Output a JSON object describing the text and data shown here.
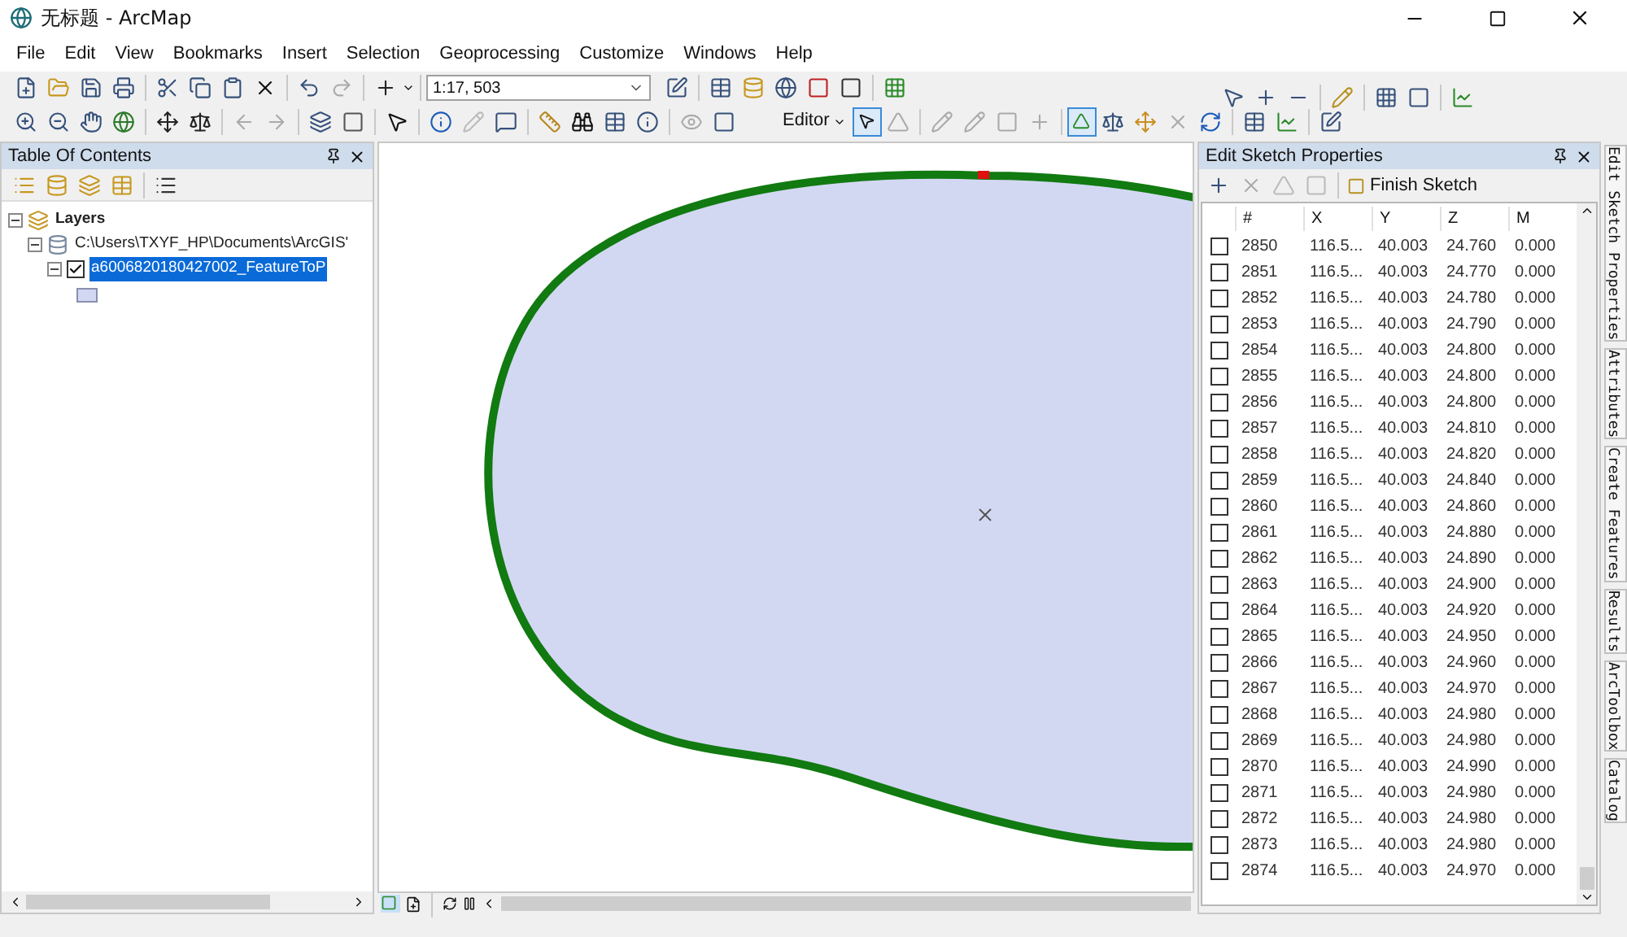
{
  "window": {
    "title": "无标题 - ArcMap"
  },
  "menu": [
    "File",
    "Edit",
    "View",
    "Bookmarks",
    "Insert",
    "Selection",
    "Geoprocessing",
    "Customize",
    "Windows",
    "Help"
  ],
  "toolbar": {
    "scale": "1:17, 503",
    "editor_menu": "Editor"
  },
  "toc": {
    "title": "Table Of Contents",
    "tree": [
      {
        "label": "Layers",
        "expanded": true,
        "children": [
          {
            "label": "C:\\Users\\TXYF_HP\\Documents\\ArcGIS'",
            "expanded": true,
            "children": [
              {
                "label": "a6006820180427002_FeatureToP",
                "checked": true,
                "selected": true,
                "expanded": true
              }
            ]
          }
        ]
      }
    ]
  },
  "sketch": {
    "title": "Edit Sketch Properties",
    "finish": "Finish Sketch",
    "columns": [
      "#",
      "X",
      "Y",
      "Z",
      "M"
    ],
    "rows": [
      {
        "checked": false,
        "cells": [
          "2850",
          "116.5...",
          "40.003",
          "24.760",
          "0.000"
        ]
      },
      {
        "checked": false,
        "cells": [
          "2851",
          "116.5...",
          "40.003",
          "24.770",
          "0.000"
        ]
      },
      {
        "checked": false,
        "cells": [
          "2852",
          "116.5...",
          "40.003",
          "24.780",
          "0.000"
        ]
      },
      {
        "checked": false,
        "cells": [
          "2853",
          "116.5...",
          "40.003",
          "24.790",
          "0.000"
        ]
      },
      {
        "checked": false,
        "cells": [
          "2854",
          "116.5...",
          "40.003",
          "24.800",
          "0.000"
        ]
      },
      {
        "checked": false,
        "cells": [
          "2855",
          "116.5...",
          "40.003",
          "24.800",
          "0.000"
        ]
      },
      {
        "checked": false,
        "cells": [
          "2856",
          "116.5...",
          "40.003",
          "24.800",
          "0.000"
        ]
      },
      {
        "checked": false,
        "cells": [
          "2857",
          "116.5...",
          "40.003",
          "24.810",
          "0.000"
        ]
      },
      {
        "checked": false,
        "cells": [
          "2858",
          "116.5...",
          "40.003",
          "24.820",
          "0.000"
        ]
      },
      {
        "checked": false,
        "cells": [
          "2859",
          "116.5...",
          "40.003",
          "24.840",
          "0.000"
        ]
      },
      {
        "checked": false,
        "cells": [
          "2860",
          "116.5...",
          "40.003",
          "24.860",
          "0.000"
        ]
      },
      {
        "checked": false,
        "cells": [
          "2861",
          "116.5...",
          "40.003",
          "24.880",
          "0.000"
        ]
      },
      {
        "checked": false,
        "cells": [
          "2862",
          "116.5...",
          "40.003",
          "24.890",
          "0.000"
        ]
      },
      {
        "checked": false,
        "cells": [
          "2863",
          "116.5...",
          "40.003",
          "24.900",
          "0.000"
        ]
      },
      {
        "checked": false,
        "cells": [
          "2864",
          "116.5...",
          "40.003",
          "24.920",
          "0.000"
        ]
      },
      {
        "checked": false,
        "cells": [
          "2865",
          "116.5...",
          "40.003",
          "24.950",
          "0.000"
        ]
      },
      {
        "checked": false,
        "cells": [
          "2866",
          "116.5...",
          "40.003",
          "24.960",
          "0.000"
        ]
      },
      {
        "checked": false,
        "cells": [
          "2867",
          "116.5...",
          "40.003",
          "24.970",
          "0.000"
        ]
      },
      {
        "checked": false,
        "cells": [
          "2868",
          "116.5...",
          "40.003",
          "24.980",
          "0.000"
        ]
      },
      {
        "checked": false,
        "cells": [
          "2869",
          "116.5...",
          "40.003",
          "24.980",
          "0.000"
        ]
      },
      {
        "checked": false,
        "cells": [
          "2870",
          "116.5...",
          "40.003",
          "24.990",
          "0.000"
        ]
      },
      {
        "checked": false,
        "cells": [
          "2871",
          "116.5...",
          "40.003",
          "24.980",
          "0.000"
        ]
      },
      {
        "checked": false,
        "cells": [
          "2872",
          "116.5...",
          "40.003",
          "24.980",
          "0.000"
        ]
      },
      {
        "checked": false,
        "cells": [
          "2873",
          "116.5...",
          "40.003",
          "24.980",
          "0.000"
        ]
      },
      {
        "checked": false,
        "cells": [
          "2874",
          "116.5...",
          "40.003",
          "24.970",
          "0.000"
        ]
      }
    ]
  },
  "side_tabs": [
    "Edit Sketch Properties",
    "Attributes",
    "Create Features",
    "Results",
    "ArcToolbox",
    "Catalog"
  ]
}
